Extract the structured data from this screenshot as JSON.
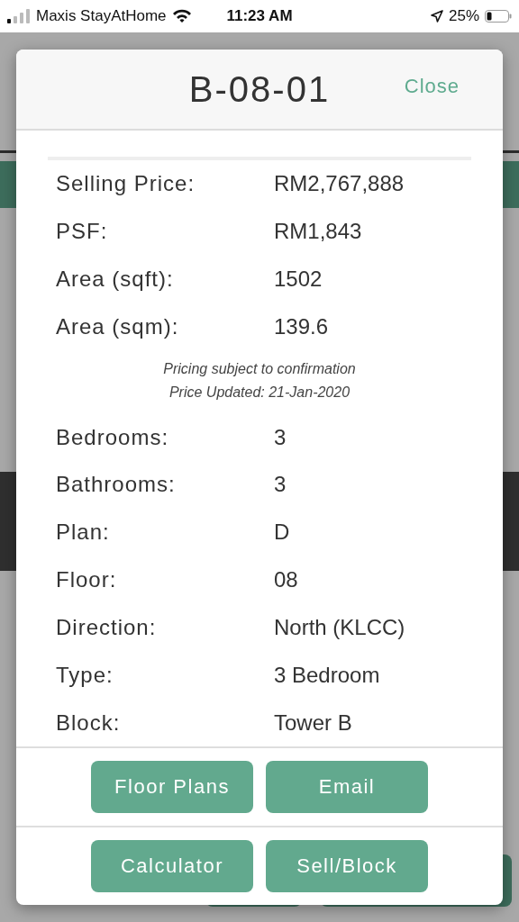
{
  "status_bar": {
    "carrier": "Maxis StayAtHome",
    "time": "11:23 AM",
    "battery": "25%"
  },
  "modal": {
    "title": "B-08-01",
    "close": "Close",
    "price_rows": [
      {
        "label": "Selling Price:",
        "value": "RM2,767,888"
      },
      {
        "label": "PSF:",
        "value": "RM1,843"
      },
      {
        "label": "Area (sqft):",
        "value": "1502"
      },
      {
        "label": "Area (sqm):",
        "value": "139.6"
      }
    ],
    "notes": [
      "Pricing subject to confirmation",
      "Price Updated: 21-Jan-2020"
    ],
    "detail_rows": [
      {
        "label": "Bedrooms:",
        "value": "3"
      },
      {
        "label": "Bathrooms:",
        "value": "3"
      },
      {
        "label": "Plan:",
        "value": "D"
      },
      {
        "label": "Floor:",
        "value": "08"
      },
      {
        "label": "Direction:",
        "value": "North (KLCC)"
      },
      {
        "label": "Type:",
        "value": "3 Bedroom"
      },
      {
        "label": "Block:",
        "value": "Tower B"
      }
    ],
    "button_rows": [
      [
        "Floor Plans",
        "Email"
      ],
      [
        "Calculator",
        "Sell/Block"
      ]
    ]
  }
}
